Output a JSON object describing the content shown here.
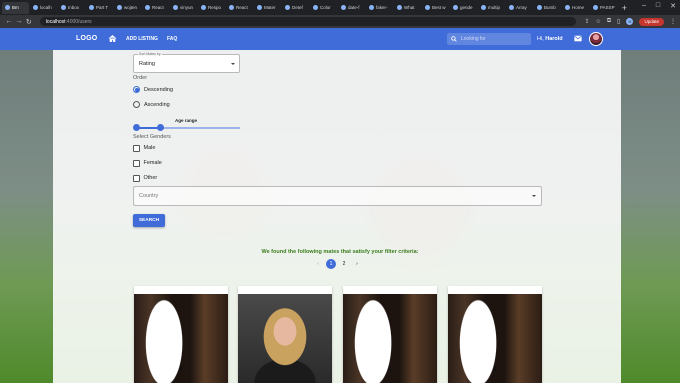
{
  "browser": {
    "tabs": [
      {
        "label": "Bm"
      },
      {
        "label": "localh"
      },
      {
        "label": "Inbox"
      },
      {
        "label": "Part T"
      },
      {
        "label": "wojten"
      },
      {
        "label": "React"
      },
      {
        "label": "vinyun"
      },
      {
        "label": "Respo"
      },
      {
        "label": "React"
      },
      {
        "label": "Mater"
      },
      {
        "label": "Detef"
      },
      {
        "label": "Color"
      },
      {
        "label": "date-f"
      },
      {
        "label": "faker-"
      },
      {
        "label": "What"
      },
      {
        "label": "Best w"
      },
      {
        "label": "gende"
      },
      {
        "label": "multip"
      },
      {
        "label": "Array"
      },
      {
        "label": "Bumb"
      },
      {
        "label": "Home"
      },
      {
        "label": "PASSP"
      }
    ],
    "url_host": "localhost",
    "url_path": ":4000/users",
    "update_label": "Update",
    "profile_initial": "H"
  },
  "header": {
    "logo": "LOGO",
    "nav": [
      "ADD LISTING",
      "FAQ"
    ],
    "search_placeholder": "Looking for",
    "greeting_prefix": "Hi, ",
    "user_name": "Harold"
  },
  "filters": {
    "sort_legend": "Sort Mates by",
    "sort_value": "Rating",
    "order_label": "Order",
    "order_options": [
      "Descending",
      "Ascending"
    ],
    "order_selected": "Descending",
    "age_label": "Age range",
    "age_range_fraction": [
      0,
      0.22
    ],
    "genders_label": "Select Genders",
    "genders": [
      "Male",
      "Female",
      "Other"
    ],
    "country_placeholder": "Country",
    "search_button": "SEARCH"
  },
  "results": {
    "message": "We found the following mates that satisfy your filter criteria:",
    "pages": [
      "1",
      "2"
    ],
    "current_page": "1",
    "prev_icon": "‹",
    "next_icon": "›"
  },
  "colors": {
    "primary": "#3f6cd8",
    "success_text": "#3a7d1c"
  }
}
